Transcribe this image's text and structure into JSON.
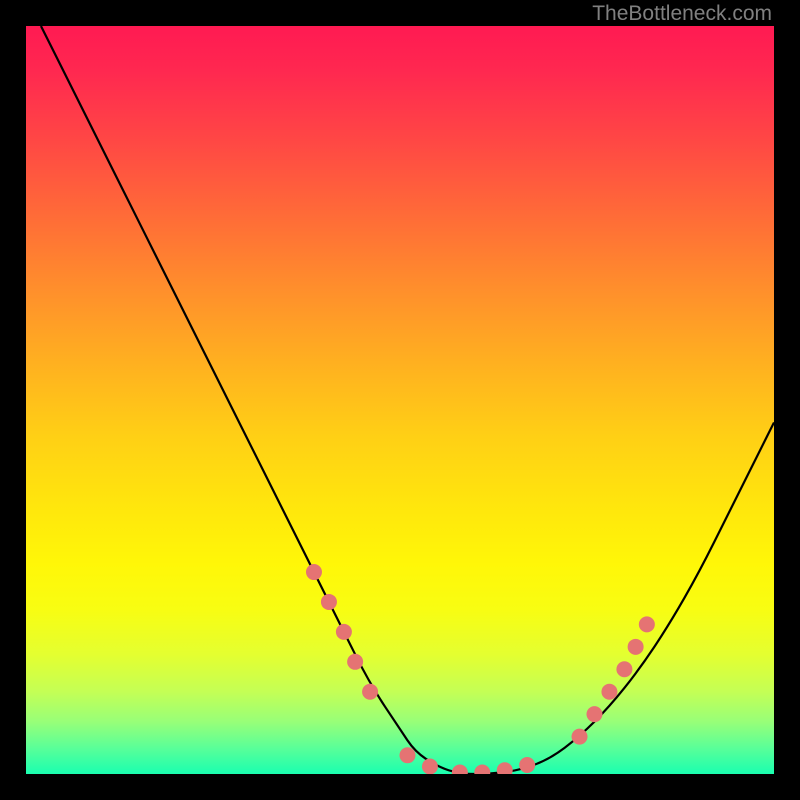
{
  "watermark": "TheBottleneck.com",
  "chart_data": {
    "type": "line",
    "title": "",
    "xlabel": "",
    "ylabel": "",
    "xlim": [
      0,
      100
    ],
    "ylim": [
      0,
      100
    ],
    "background_gradient": {
      "stops": [
        {
          "offset": 0.0,
          "color": "#ff1a52"
        },
        {
          "offset": 0.06,
          "color": "#ff2850"
        },
        {
          "offset": 0.15,
          "color": "#ff4645"
        },
        {
          "offset": 0.25,
          "color": "#ff6a38"
        },
        {
          "offset": 0.35,
          "color": "#ff8e2c"
        },
        {
          "offset": 0.45,
          "color": "#ffb020"
        },
        {
          "offset": 0.55,
          "color": "#ffd015"
        },
        {
          "offset": 0.65,
          "color": "#ffe80c"
        },
        {
          "offset": 0.72,
          "color": "#fff708"
        },
        {
          "offset": 0.78,
          "color": "#f8fd12"
        },
        {
          "offset": 0.84,
          "color": "#e4ff30"
        },
        {
          "offset": 0.89,
          "color": "#c4ff55"
        },
        {
          "offset": 0.93,
          "color": "#98ff78"
        },
        {
          "offset": 0.965,
          "color": "#5aff98"
        },
        {
          "offset": 1.0,
          "color": "#1affb0"
        }
      ]
    },
    "series": [
      {
        "name": "curve",
        "stroke": "#000000",
        "stroke_width": 2.2,
        "x": [
          2,
          6,
          10,
          14,
          18,
          22,
          26,
          30,
          34,
          38,
          42,
          46,
          50,
          52,
          55,
          58,
          62,
          66,
          70,
          74,
          78,
          82,
          86,
          90,
          94,
          98,
          100
        ],
        "y": [
          100,
          92,
          84,
          76,
          68,
          60,
          52,
          44,
          36,
          28,
          20,
          12,
          6,
          3,
          1,
          0,
          0,
          0.5,
          2,
          5,
          9,
          14,
          20,
          27,
          35,
          43,
          47
        ]
      }
    ],
    "markers": {
      "name": "highlight-dots",
      "fill": "#e57373",
      "radius": 8,
      "points": [
        {
          "x": 38.5,
          "y": 27
        },
        {
          "x": 40.5,
          "y": 23
        },
        {
          "x": 42.5,
          "y": 19
        },
        {
          "x": 44.0,
          "y": 15
        },
        {
          "x": 46.0,
          "y": 11
        },
        {
          "x": 51.0,
          "y": 2.5
        },
        {
          "x": 54.0,
          "y": 1.0
        },
        {
          "x": 58.0,
          "y": 0.2
        },
        {
          "x": 61.0,
          "y": 0.2
        },
        {
          "x": 64.0,
          "y": 0.5
        },
        {
          "x": 67.0,
          "y": 1.2
        },
        {
          "x": 74.0,
          "y": 5
        },
        {
          "x": 76.0,
          "y": 8
        },
        {
          "x": 78.0,
          "y": 11
        },
        {
          "x": 80.0,
          "y": 14
        },
        {
          "x": 81.5,
          "y": 17
        },
        {
          "x": 83.0,
          "y": 20
        }
      ]
    }
  }
}
